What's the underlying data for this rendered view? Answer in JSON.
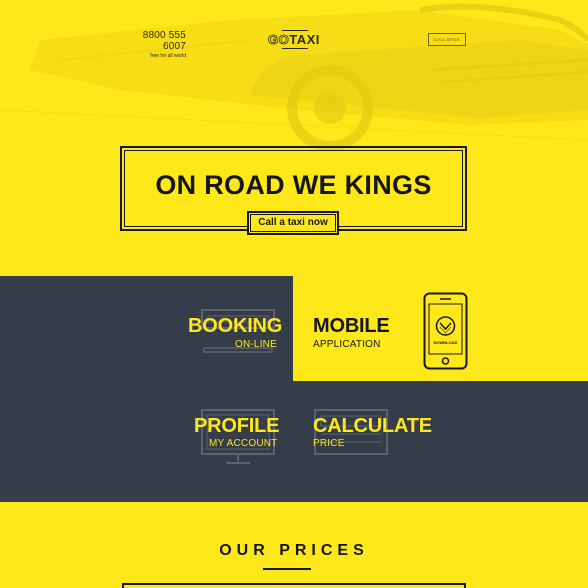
{
  "header": {
    "phone_number": "8800 555 6007",
    "phone_caption": "free for all world",
    "logo_go": "GO",
    "logo_taxi": "TAXI",
    "callback_label": "CALL BACK"
  },
  "hero": {
    "headline": "ON ROAD WE KINGS",
    "cta_label": "Call a taxi now"
  },
  "features": {
    "booking": {
      "title": "BOOKING",
      "subtitle": "ON-LINE"
    },
    "mobile": {
      "title": "MOBILE",
      "subtitle": "APPLICATION",
      "phone_screen_label": "DOWNLOAD"
    },
    "profile": {
      "title": "PROFILE",
      "subtitle": "MY ACCOUNT"
    },
    "calculate": {
      "title": "CALCULATE",
      "subtitle": "PRICE"
    }
  },
  "prices": {
    "title": "OUR PRICES"
  },
  "colors": {
    "accent_yellow": "#ffe81a",
    "panel_dark": "#353d4b",
    "text_dark": "#16161d"
  }
}
